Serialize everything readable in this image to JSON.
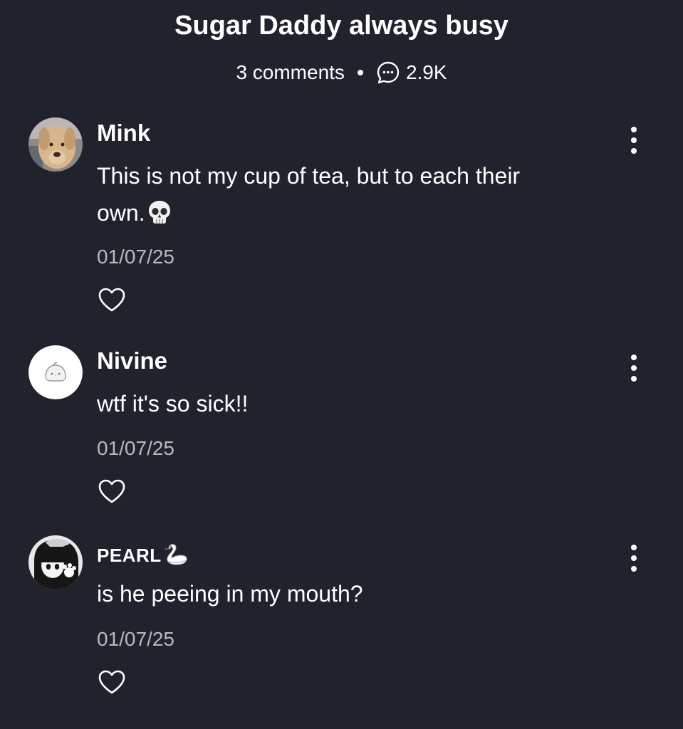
{
  "post": {
    "title": "Sugar Daddy always busy",
    "comments_count": "3 comments",
    "views": "2.9K"
  },
  "comments": [
    {
      "username": "Mink",
      "text": "This is not my cup of tea, but to each their own.",
      "emoji": "skull-emoji",
      "date": "01/07/25",
      "avatar": "dog-photo"
    },
    {
      "username": "Nivine",
      "text": "wtf it's so sick!!",
      "date": "01/07/25",
      "avatar": "chick-icon"
    },
    {
      "username": "PEARL",
      "username_emoji": "swan-emoji",
      "text": "is he peeing in my mouth?",
      "date": "01/07/25",
      "avatar": "anime-character-photo"
    }
  ],
  "colors": {
    "background": "#20222c",
    "text": "#ffffff",
    "secondary_text": "#b9bac0"
  }
}
